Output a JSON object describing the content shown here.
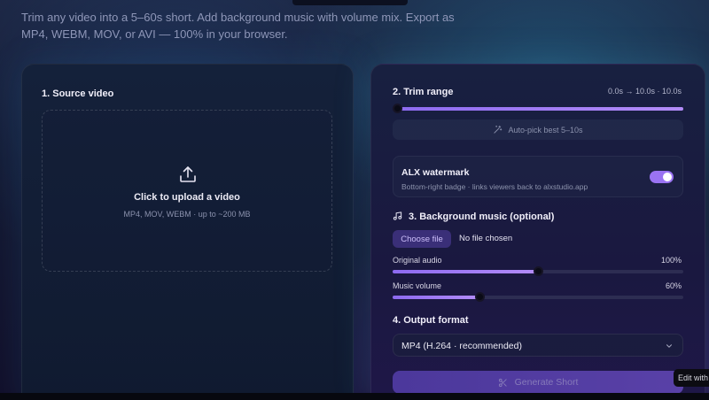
{
  "intro": {
    "line1": "Trim any video into a 5–60s short. Add background music with volume mix. Export as",
    "line2": "MP4, WEBM, MOV, or AVI — 100% in your browser."
  },
  "source": {
    "title": "1. Source video",
    "upload_title": "Click to upload a video",
    "upload_sub": "MP4, MOV, WEBM · up to ~200 MB"
  },
  "trim": {
    "title": "2. Trim range",
    "readout": "0.0s → 10.0s · 10.0s",
    "range_start_fraction": 0.0,
    "range_end_fraction": 1.0,
    "autopick_label": "Auto-pick best 5–10s"
  },
  "watermark": {
    "title": "ALX watermark",
    "subtitle": "Bottom-right badge · links viewers back to alxstudio.app",
    "enabled": true
  },
  "music": {
    "title": "3. Background music (optional)",
    "choose_file_label": "Choose file",
    "file_status": "No file chosen",
    "original_audio_label": "Original audio",
    "original_audio_value": "100%",
    "original_audio_fraction": 0.5,
    "music_volume_label": "Music volume",
    "music_volume_value": "60%",
    "music_volume_fraction": 0.3
  },
  "output": {
    "title": "4. Output format",
    "selected": "MP4 (H.264 · recommended)"
  },
  "generate_label": "Generate Short",
  "edit_badge": "Edit with",
  "colors": {
    "accent": "#9a73f2",
    "track": "#2d2d52",
    "button_bg": "#3a2f78"
  }
}
